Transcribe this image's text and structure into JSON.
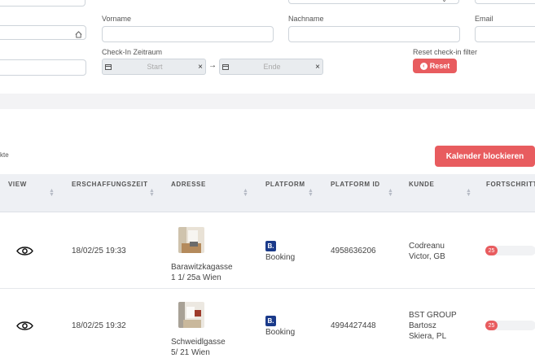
{
  "filters": {
    "vorname_label": "Vorname",
    "nachname_label": "Nachname",
    "email_label": "Email",
    "checkin_label": "Check-In Zeitraum",
    "start_placeholder": "Start",
    "end_placeholder": "Ende",
    "reset_label": "Reset check-in filter",
    "reset_button": "Reset"
  },
  "toolbar": {
    "left_text": "kte",
    "block_calendar_button": "Kalender blockieren"
  },
  "table": {
    "headers": [
      "VIEW",
      "ERSCHAFFUNGSZEIT",
      "ADRESSE",
      "PLATFORM",
      "PLATFORM ID",
      "KUNDE",
      "FORTSCHRITT"
    ],
    "rows": [
      {
        "created": "18/02/25 19:33",
        "address_line1": "Barawitzkagasse",
        "address_line2": "1 1/ 25a Wien",
        "platform_icon": "B.",
        "platform": "Booking",
        "platform_id": "4958636206",
        "customer_line1": "Codreanu",
        "customer_line2": "Victor, GB",
        "customer_line3": "",
        "progress": "25"
      },
      {
        "created": "18/02/25 19:32",
        "address_line1": "Schweidlgasse",
        "address_line2": "5/ 21 Wien",
        "platform_icon": "B.",
        "platform": "Booking",
        "platform_id": "4994427448",
        "customer_line1": "BST GROUP",
        "customer_line2": "Bartosz",
        "customer_line3": "Skiera, PL",
        "progress": "25"
      }
    ]
  },
  "colors": {
    "accent_red": "#e85c5f",
    "booking_blue": "#1a3a8a",
    "header_bg": "#eef0f4"
  }
}
